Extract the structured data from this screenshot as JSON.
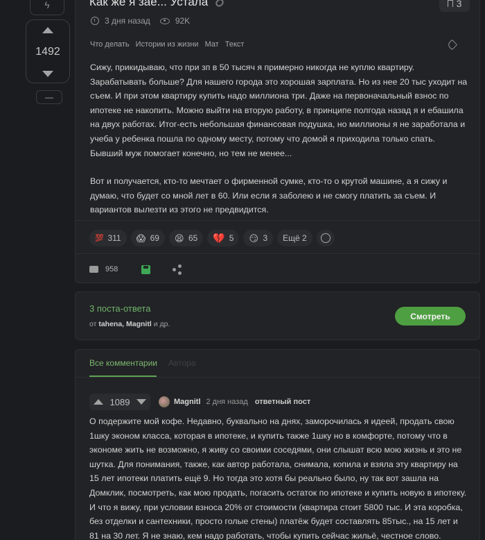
{
  "sidebar": {
    "score": "1492",
    "minus_label": "—"
  },
  "post": {
    "title": "Как же я зае... Устала",
    "saves_count": "3",
    "time": "3 дня назад",
    "views": "92K",
    "tags": [
      "Что делать",
      "Истории из жизни",
      "Мат",
      "Текст"
    ],
    "paragraph1": "Сижу, прикидываю, что при зп в 50 тысяч я примерно никогда не куплю квартиру. Зарабатывать больше? Для нашего города это хорошая зарплата. Но из нее 20 тыс уходит на съем. И при этом квартиру купить надо миллиона три. Даже на первоначальный взнос по ипотеке не накопить. Можно выйти на вторую работу, в принципе полгода назад я и ебашила на двух работах. Итог-есть небольшая финансовая подушка, но миллионы я не заработала и учеба у ребенка пошла по одному месту, потому что домой я приходила только спать. Бывший муж помогает конечно, но тем не менее...",
    "paragraph2": "Вот и получается, кто-то мечтает о фирменной сумке, кто-то о крутой машине, а я сижу и думаю, что будет со мной лет в 60. Или если я заболею и не смогу платить за съем. И вариантов вылезти из этого не предвидится.",
    "reactions": [
      {
        "emoji": "💯",
        "count": "311"
      },
      {
        "emoji": "😱",
        "count": "69"
      },
      {
        "emoji": "😫",
        "count": "65"
      },
      {
        "emoji": "💔",
        "count": "5"
      },
      {
        "emoji": "😏",
        "count": "3"
      }
    ],
    "more_reactions": "Ещё 2",
    "comments_count": "958"
  },
  "replies": {
    "title": "3 поста-ответа",
    "prefix": "от",
    "authors": "tahena, Magnitl",
    "suffix": "и др.",
    "button": "Смотреть"
  },
  "comments": {
    "tab_all": "Все комментарии",
    "tab_author": "Автора",
    "first": {
      "score": "1089",
      "author": "Magnitl",
      "time": "2 дня назад",
      "badge": "ответный пост",
      "text": "О подержите мой кофе. Недавно, буквально на днях, заморочилась я идеей, продать свою 1шку эконом класса, которая в ипотеке, и купить также 1шку но в комфорте, потому что в экономе жить не возможно, я живу со своими соседями, они слышат всю мою жизнь и это не шутка. Для понимания, также, как автор работала, снимала, копила и взяла эту квартиру на 15 лет ипотеки платить ещё 9. Но тогда это хотя бы реально было, ну так вот зашла на Домклик, посмотреть, как мою продать, погасить остаток по ипотеке и купить новую в ипотеку. И что я вижу, при условии взноса 20% от стоимости (квартира стоит 5800 тыс. И эта коробка, без отделки и сантехники, просто голые стены) платёж будет составлять 85тыс., на 15 лет и 81 на 30 лет. Я не знаю, кем надо работать, чтобы купить сейчас жильё, честное слово."
    }
  },
  "colors": {
    "accent_green": "#5ea454",
    "button_green": "#4e9e42",
    "background": "#1b1c1f",
    "card": "#222326"
  }
}
